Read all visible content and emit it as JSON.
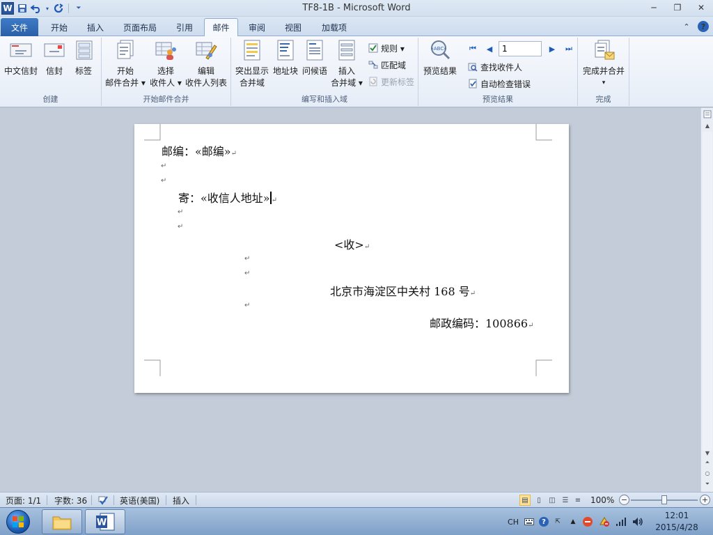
{
  "window": {
    "title": "TF8-1B  -  Microsoft Word",
    "app_icon_letter": "W",
    "controls": {
      "minimize": "─",
      "restore": "❐",
      "close": "✕"
    }
  },
  "qat": {
    "save_icon": "save-icon",
    "undo_icon": "undo-icon",
    "redo_icon": "redo-icon",
    "customize_icon": "customize-qat-icon"
  },
  "tabs": [
    {
      "label": "文件"
    },
    {
      "label": "开始"
    },
    {
      "label": "插入"
    },
    {
      "label": "页面布局"
    },
    {
      "label": "引用"
    },
    {
      "label": "邮件"
    },
    {
      "label": "审阅"
    },
    {
      "label": "视图"
    },
    {
      "label": "加载项"
    }
  ],
  "active_tab": "邮件",
  "tab_right": {
    "collapse": "⌃",
    "help": "?"
  },
  "ribbon": {
    "groups": {
      "create": {
        "label": "创建",
        "buttons": [
          "中文信封",
          "信封",
          "标签"
        ]
      },
      "start_merge": {
        "label": "开始邮件合并",
        "buttons": [
          {
            "line1": "开始",
            "line2": "邮件合并 ▾"
          },
          {
            "line1": "选择",
            "line2": "收件人 ▾"
          },
          {
            "line1": "编辑",
            "line2": "收件人列表"
          }
        ]
      },
      "write_insert": {
        "label": "编写和插入域",
        "buttons": [
          {
            "line1": "突出显示",
            "line2": "合并域"
          },
          {
            "line1": "地址块",
            "line2": ""
          },
          {
            "line1": "问候语",
            "line2": ""
          },
          {
            "line1": "插入",
            "line2": "合并域 ▾"
          }
        ],
        "small": [
          "规则 ▾",
          "匹配域",
          "更新标签"
        ]
      },
      "preview": {
        "label": "预览结果",
        "big": "预览结果",
        "record_value": "1",
        "small": [
          "查找收件人",
          "自动检查错误"
        ]
      },
      "finish": {
        "label": "完成",
        "big": "完成并合并",
        "arrow": "▾"
      }
    }
  },
  "document": {
    "lines": [
      "邮编：«邮编»",
      "寄：«收信人地址»",
      "<收>",
      "北京市海淀区中关村 168 号",
      "邮政编码：100866"
    ],
    "paragraph_mark": "↵"
  },
  "statusbar": {
    "page": "页面: 1/1",
    "words": "字数: 36",
    "language": "英语(美国)",
    "mode": "插入",
    "zoom": "100%",
    "zoom_fraction": 0.5
  },
  "taskbar": {
    "ime": "CH",
    "time": "12:01",
    "date": "2015/4/28"
  }
}
